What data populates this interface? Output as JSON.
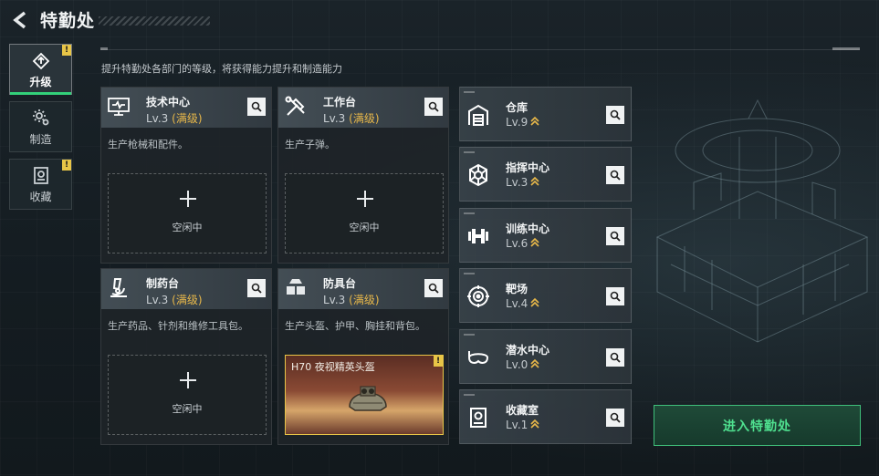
{
  "header": {
    "title": "特勤处"
  },
  "subtitle": "提升特勤处各部门的等级，将获得能力提升和制造能力",
  "nav": [
    {
      "label": "升级",
      "icon": "upgrade-icon",
      "alert": "!"
    },
    {
      "label": "制造",
      "icon": "gear-icon",
      "alert": ""
    },
    {
      "label": "收藏",
      "icon": "collection-icon",
      "alert": "!"
    }
  ],
  "cards": [
    {
      "name": "技术中心",
      "level": "Lv.3",
      "max": "(满级)",
      "desc": "生产枪械和配件。",
      "slot": "空闲中",
      "icon": "computer-icon"
    },
    {
      "name": "工作台",
      "level": "Lv.3",
      "max": "(满级)",
      "desc": "生产子弹。",
      "slot": "空闲中",
      "icon": "tools-icon"
    },
    {
      "name": "制药台",
      "level": "Lv.3",
      "max": "(满级)",
      "desc": "生产药品、针剂和维修工具包。",
      "slot": "空闲中",
      "icon": "microscope-icon"
    },
    {
      "name": "防具台",
      "level": "Lv.3",
      "max": "(满级)",
      "desc": "生产头盔、护甲、胸挂和背包。",
      "craft": "H70 夜视精英头盔",
      "craft_alert": "!",
      "icon": "armor-icon"
    }
  ],
  "facilities": [
    {
      "name": "仓库",
      "level": "Lv.9",
      "icon": "warehouse-icon"
    },
    {
      "name": "指挥中心",
      "level": "Lv.3",
      "icon": "command-icon"
    },
    {
      "name": "训练中心",
      "level": "Lv.6",
      "icon": "dumbbell-icon"
    },
    {
      "name": "靶场",
      "level": "Lv.4",
      "icon": "target-icon"
    },
    {
      "name": "潜水中心",
      "level": "Lv.0",
      "icon": "diving-mask-icon"
    },
    {
      "name": "收藏室",
      "level": "Lv.1",
      "icon": "collection-room-icon"
    }
  ],
  "enter_button": "进入特勤处",
  "colors": {
    "accent_green": "#33d17a",
    "max_level": "#e8b84a",
    "alert": "#e8c547"
  }
}
